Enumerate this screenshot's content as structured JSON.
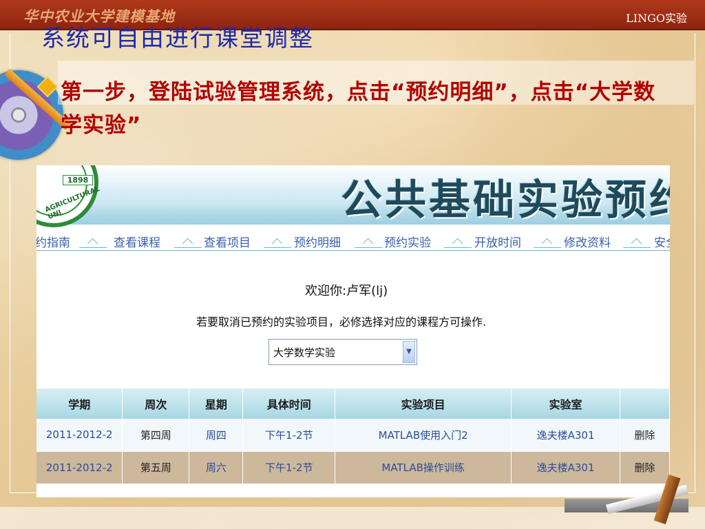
{
  "banner": {
    "left": "华中农业大学建模基地",
    "right": "LINGO实验"
  },
  "slide": {
    "title": "系统可自由进行课堂调整",
    "bullet": "第一步，登陆试验管理系统，点击“预约明细”，点击“大学数学实验”"
  },
  "shot": {
    "logo_year": "1898",
    "logo_text": "AGRICULTURAL UNI",
    "system_title": "公共基础实验预约系统",
    "nav": [
      "约指南",
      "查看课程",
      "查看项目",
      "预约明细",
      "预约实验",
      "开放时间",
      "修改资料",
      "安全"
    ],
    "welcome": "欢迎你:卢军(lj)",
    "notice": "若要取消已预约的实验项目，必修选择对应的课程方可操作.",
    "select_value": "大学数学实验",
    "select_arrow": "▼",
    "table": {
      "headers": [
        "学期",
        "周次",
        "星期",
        "具体时间",
        "实验项目",
        "实验室",
        ""
      ],
      "rows": [
        [
          "2011-2012-2",
          "第四周",
          "周四",
          "下午1-2节",
          "MATLAB使用入门2",
          "逸夫楼A301",
          "删除"
        ],
        [
          "2011-2012-2",
          "第五周",
          "周六",
          "下午1-2节",
          "MATLAB操作训练",
          "逸夫楼A301",
          "删除"
        ]
      ]
    }
  },
  "colors": {
    "banner": "#9e2c12",
    "title": "#1e2aa8",
    "bullet": "#b20000",
    "nav_link": "#3a5fb0",
    "table_header": "#a8d7e3",
    "row_highlight": "#cdb89c"
  },
  "icons": [
    "cd-decoration",
    "pencil-decoration",
    "diamond-bullet-icon",
    "dropdown-arrow-icon",
    "university-logo"
  ]
}
